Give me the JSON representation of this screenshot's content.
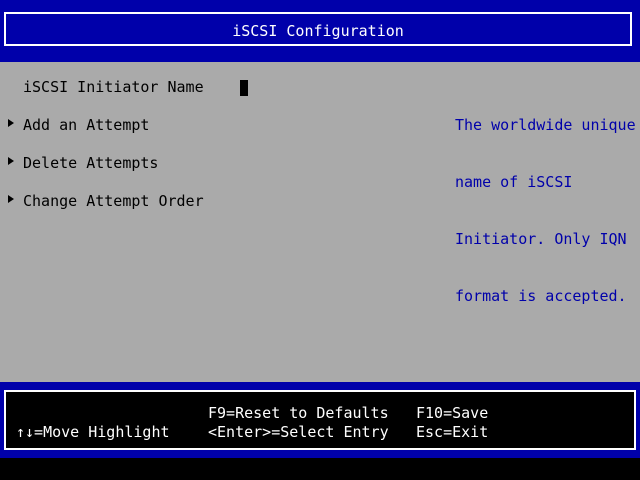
{
  "header": {
    "title": "iSCSI Configuration"
  },
  "menu": {
    "initiator_name": {
      "label": "iSCSI Initiator Name",
      "value": ""
    },
    "items": [
      {
        "label": "Add an Attempt",
        "icon": "triangle-right-icon"
      },
      {
        "label": "Delete Attempts",
        "icon": "triangle-right-icon"
      },
      {
        "label": "Change Attempt Order",
        "icon": "triangle-right-icon"
      }
    ]
  },
  "help": {
    "lines": [
      "The worldwide unique",
      "name of iSCSI",
      "Initiator. Only IQN",
      "format is accepted."
    ]
  },
  "footer": {
    "move_highlight": "↑↓=Move Highlight",
    "reset_defaults": "F9=Reset to Defaults",
    "select_entry": "<Enter>=Select Entry",
    "save": "F10=Save",
    "exit": "Esc=Exit"
  },
  "colors": {
    "background": "#aaaaaa",
    "band": "#0000aa",
    "help_text": "#0000aa",
    "footer_box": "#000000",
    "header_text": "#ffffff"
  }
}
